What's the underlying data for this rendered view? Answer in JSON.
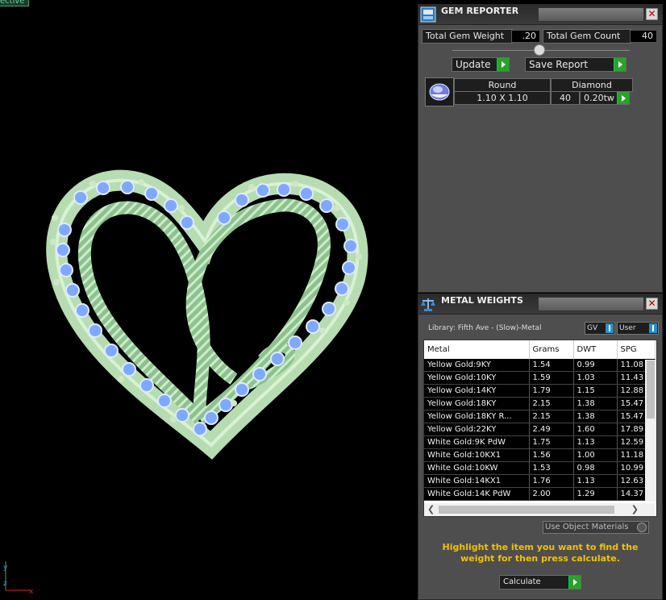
{
  "viewport": {
    "tab_label": "ective",
    "axis": {
      "y": "y",
      "z": "z",
      "x": "x"
    }
  },
  "gem_reporter": {
    "title": "GEM REPORTER",
    "close_symbol": "✕",
    "total_weight_label": "Total Gem Weight",
    "total_weight_value": ".20",
    "total_count_label": "Total Gem Count",
    "total_count_value": "40",
    "update_label": "Update",
    "save_report_label": "Save Report",
    "gem": {
      "shape": "Round",
      "material": "Diamond",
      "size": "1.10 X 1.10",
      "count": "40",
      "weight": "0.20tw",
      "icon": "round-gem-icon"
    }
  },
  "metal_weights": {
    "title": "METAL WEIGHTS",
    "close_symbol": "✕",
    "library": "Library: Fifth Ave - (Slow)-Metal",
    "gv_label": "GV",
    "user_label": "User",
    "columns": [
      "Metal",
      "Grams",
      "DWT",
      "SPG"
    ],
    "rows": [
      [
        "Yellow Gold:9KY",
        "1.54",
        "0.99",
        "11.08"
      ],
      [
        "Yellow Gold:10KY",
        "1.59",
        "1.03",
        "11.43"
      ],
      [
        "Yellow Gold:14KY",
        "1.79",
        "1.15",
        "12.88"
      ],
      [
        "Yellow Gold:18KY",
        "2.15",
        "1.38",
        "15.47"
      ],
      [
        "Yellow Gold:18KY R...",
        "2.15",
        "1.38",
        "15.47"
      ],
      [
        "Yellow Gold:22KY",
        "2.49",
        "1.60",
        "17.89"
      ],
      [
        "White Gold:9K PdW",
        "1.75",
        "1.13",
        "12.59"
      ],
      [
        "White Gold:10KX1",
        "1.56",
        "1.00",
        "11.18"
      ],
      [
        "White Gold:10KW",
        "1.53",
        "0.98",
        "10.99"
      ],
      [
        "White Gold:14KX1",
        "1.76",
        "1.13",
        "12.63"
      ],
      [
        "White Gold:14K PdW",
        "2.00",
        "1.29",
        "14.37"
      ]
    ],
    "use_object_materials_label": "Use Object Materials",
    "hint": "Highlight the item you want to find the weight for then press calculate.",
    "calculate_label": "Calculate"
  },
  "colors": {
    "metal_green": "#a9d7a9",
    "gem_blue": "#7fa8ff",
    "hint_yellow": "#f2c200",
    "play_green": "#29a329",
    "panel_grey": "#4e4e4e"
  }
}
